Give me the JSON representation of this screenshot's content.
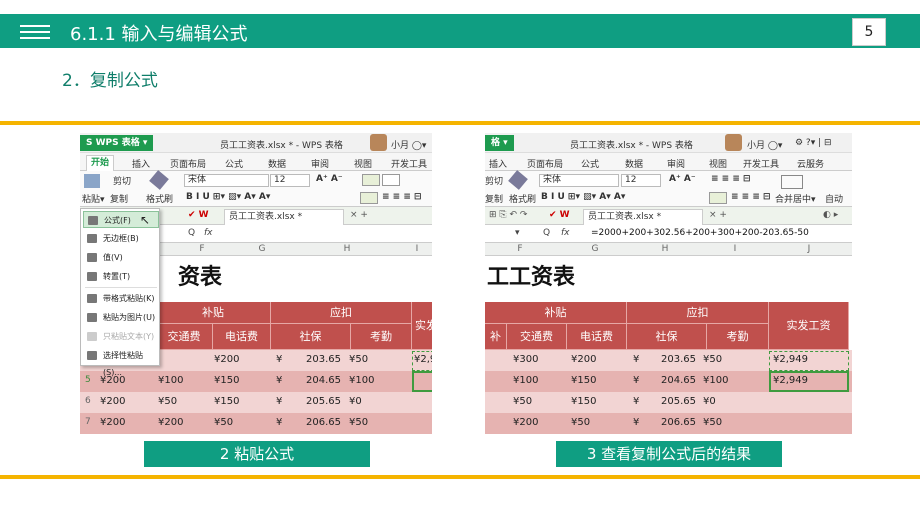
{
  "slide": {
    "title": "6.1.1 输入与编辑公式",
    "page_number": "5",
    "subtitle": "2．复制公式",
    "accent_color": "#0f9e82",
    "line_color": "#f5b400"
  },
  "left": {
    "app_tag": "S WPS 表格 ▾",
    "doc_title": "员工工资表.xlsx * - WPS 表格",
    "user": "小月 ◯▾",
    "ribbon_tabs": [
      "开始",
      "插入",
      "页面布局",
      "公式",
      "数据",
      "审阅",
      "视图",
      "开发工具"
    ],
    "cut": "剪切",
    "paste": "粘贴▾",
    "copy": "复制",
    "format_painter": "格式刷",
    "font_name": "宋体",
    "font_size": "12",
    "sheet_tab": "员工工资表.xlsx *",
    "name_box": "",
    "formula": "",
    "columns": [
      "F",
      "G",
      "H",
      "I"
    ],
    "sheet_title": "资表",
    "hdr_subsidy": "补贴",
    "hdr_payable": "应扣",
    "hdr_salary": "实发工资",
    "subhdrs": [
      "交通费",
      "电话费",
      "社保",
      "考勤"
    ],
    "paste_menu": [
      "公式(F)",
      "无边框(B)",
      "值(V)",
      "转置(T)",
      "带格式粘贴(K)",
      "粘贴为图片(U)",
      "只粘贴文本(Y)",
      "选择性粘贴(S)..."
    ],
    "rows": [
      {
        "num": "",
        "a": "",
        "b": "",
        "c": "¥200",
        "d": "¥",
        "e": "203.65",
        "f": "¥50",
        "g": "¥2,9"
      },
      {
        "num": "5",
        "a": "¥200",
        "b": "¥100",
        "c": "¥150",
        "d": "¥",
        "e": "204.65",
        "f": "¥100",
        "g": ""
      },
      {
        "num": "6",
        "a": "¥200",
        "b": "¥50",
        "c": "¥150",
        "d": "¥",
        "e": "205.65",
        "f": "¥0",
        "g": ""
      },
      {
        "num": "7",
        "a": "¥200",
        "b": "¥200",
        "c": "¥50",
        "d": "¥",
        "e": "206.65",
        "f": "¥50",
        "g": ""
      }
    ],
    "caption": "2 粘贴公式"
  },
  "right": {
    "app_tag": "格 ▾",
    "doc_title": "员工工资表.xlsx * - WPS 表格",
    "user": "小月 ◯▾",
    "ribbon_tabs": [
      "插入",
      "页面布局",
      "公式",
      "数据",
      "审阅",
      "视图",
      "开发工具",
      "云服务"
    ],
    "cut": "剪切",
    "copy": "复制",
    "format_painter": "格式刷",
    "font_name": "宋体",
    "font_size": "12",
    "merge": "合并居中▾",
    "auto": "自动",
    "sheet_tab": "员工工资表.xlsx *",
    "formula": "=2000+200+302.56+200+300+200-203.65-50",
    "columns": [
      "F",
      "G",
      "H",
      "I",
      "J"
    ],
    "sheet_title": "工工资表",
    "hdr_subsidy": "补贴",
    "hdr_payable": "应扣",
    "hdr_salary": "实发工资",
    "subhdrs": [
      "补",
      "交通费",
      "电话费",
      "社保",
      "考勤"
    ],
    "rows": [
      {
        "a": "¥300",
        "b": "¥200",
        "c": "¥",
        "d": "203.65",
        "e": "¥50",
        "f": "¥2,949"
      },
      {
        "a": "¥100",
        "b": "¥150",
        "c": "¥",
        "d": "204.65",
        "e": "¥100",
        "f": "¥2,949"
      },
      {
        "a": "¥50",
        "b": "¥150",
        "c": "¥",
        "d": "205.65",
        "e": "¥0",
        "f": ""
      },
      {
        "a": "¥200",
        "b": "¥50",
        "c": "¥",
        "d": "206.65",
        "e": "¥50",
        "f": ""
      }
    ],
    "caption": "3 查看复制公式后的结果"
  }
}
